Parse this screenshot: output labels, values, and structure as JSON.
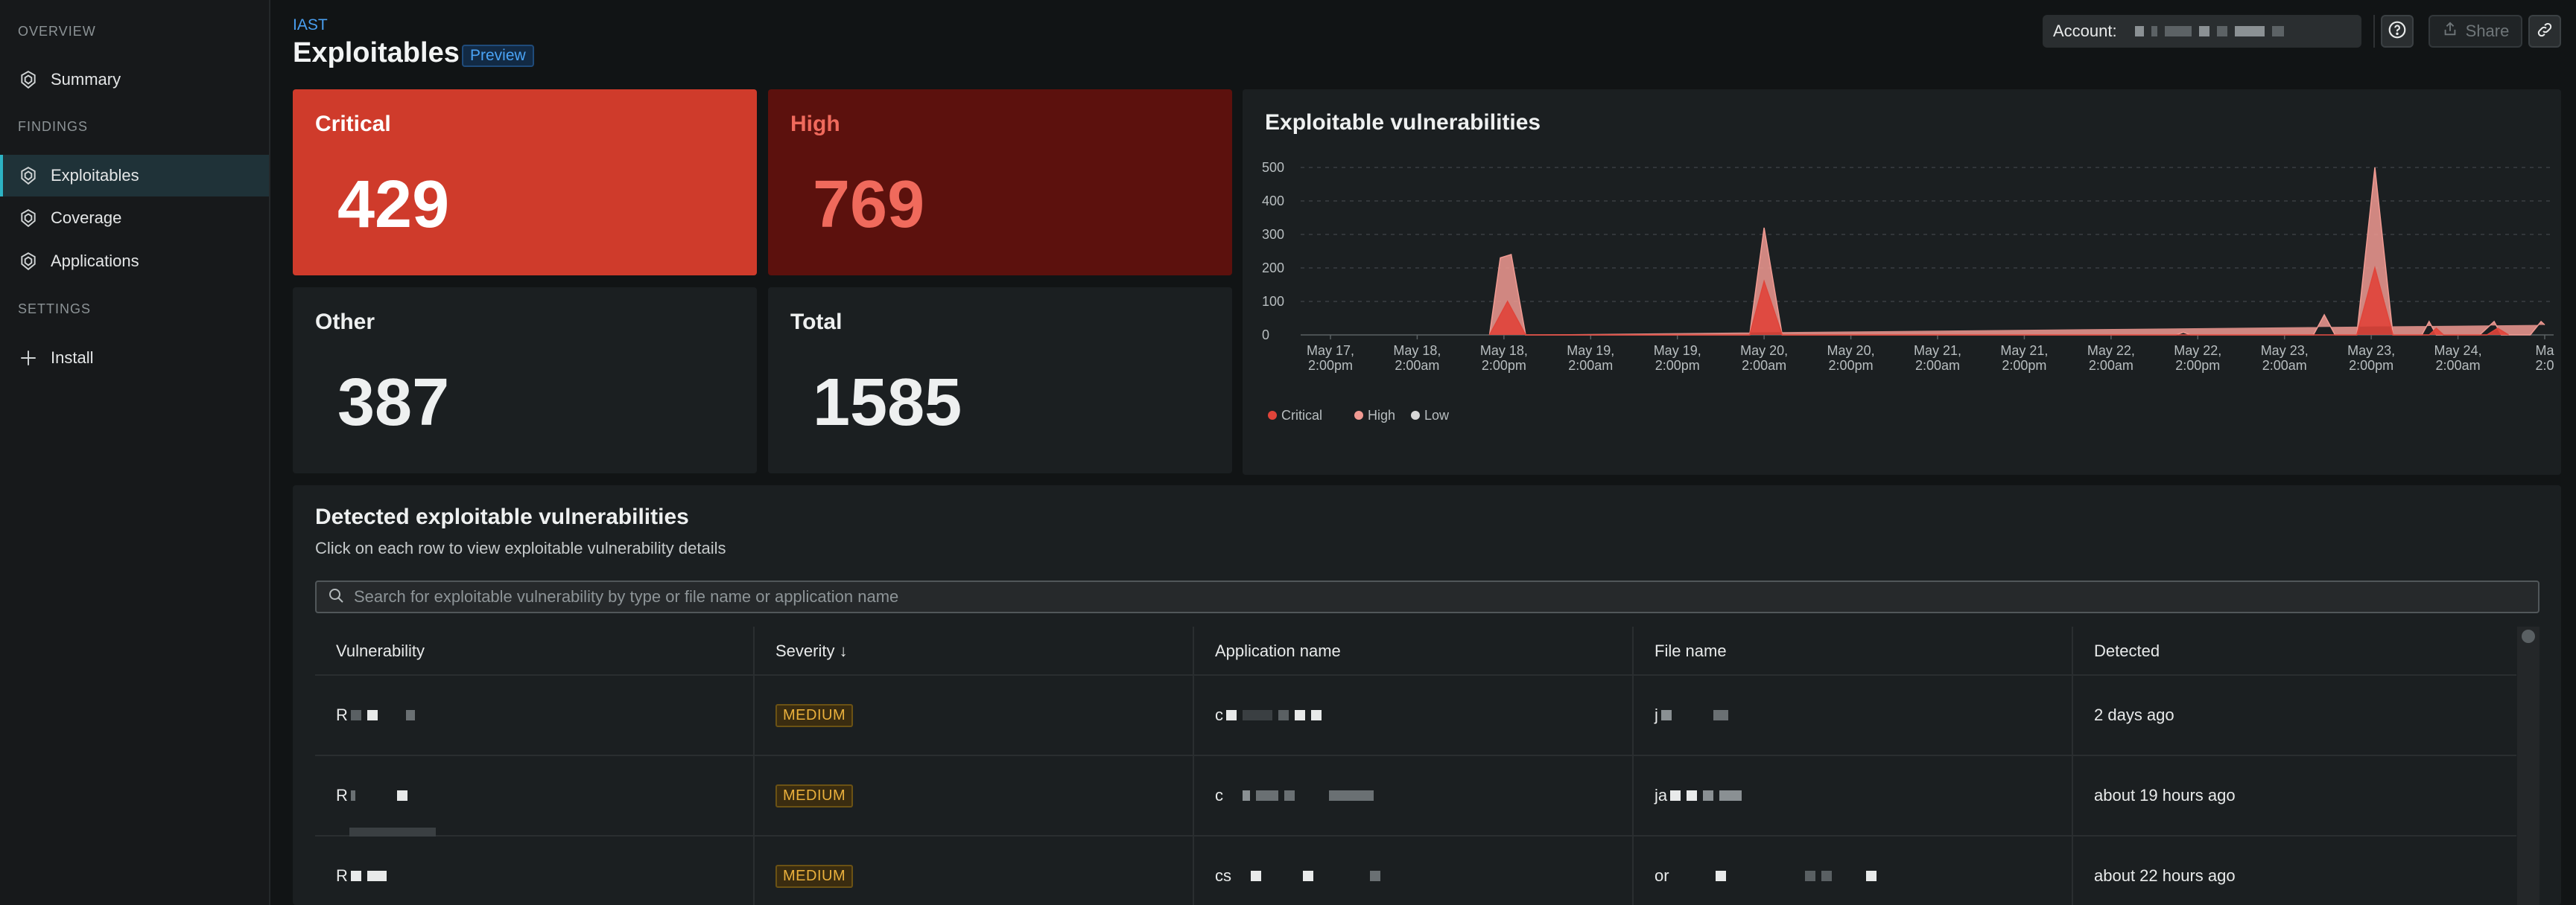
{
  "sidebar": {
    "sections": [
      {
        "title": "OVERVIEW",
        "items": [
          {
            "label": "Summary",
            "icon": "shield-icon"
          }
        ]
      },
      {
        "title": "FINDINGS",
        "items": [
          {
            "label": "Exploitables",
            "icon": "shield-icon",
            "active": true
          },
          {
            "label": "Coverage",
            "icon": "shield-icon"
          },
          {
            "label": "Applications",
            "icon": "shield-icon"
          }
        ]
      },
      {
        "title": "SETTINGS",
        "items": [
          {
            "label": "Install",
            "icon": "plus-icon"
          }
        ]
      }
    ]
  },
  "header": {
    "breadcrumb": "IAST",
    "title": "Exploitables",
    "badge": "Preview",
    "account_label": "Account:",
    "share_label": "Share"
  },
  "stats": {
    "critical": {
      "label": "Critical",
      "value": "429",
      "bg": "#cf3b2b",
      "label_color": "#ffffff",
      "value_color": "#ffffff"
    },
    "high": {
      "label": "High",
      "value": "769",
      "bg": "#5c110d",
      "label_color": "#f06a5c",
      "value_color": "#f06a5c"
    },
    "other": {
      "label": "Other",
      "value": "387",
      "bg": "#1b1f21",
      "label_color": "#eef0f0",
      "value_color": "#eef0f0"
    },
    "total": {
      "label": "Total",
      "value": "1585",
      "bg": "#1b1f21",
      "label_color": "#eef0f0",
      "value_color": "#eef0f0"
    }
  },
  "chart": {
    "title": "Exploitable vulnerabilities"
  },
  "chart_data": {
    "type": "area",
    "title": "Exploitable vulnerabilities",
    "ylim": [
      0,
      500
    ],
    "y_ticks": [
      "500",
      "400",
      "300",
      "200",
      "100",
      "0"
    ],
    "x_tick_labels": [
      [
        "May 17,",
        "2:00pm"
      ],
      [
        "May 18,",
        "2:00am"
      ],
      [
        "May 18,",
        "2:00pm"
      ],
      [
        "May 19,",
        "2:00am"
      ],
      [
        "May 19,",
        "2:00pm"
      ],
      [
        "May 20,",
        "2:00am"
      ],
      [
        "May 20,",
        "2:00pm"
      ],
      [
        "May 21,",
        "2:00am"
      ],
      [
        "May 21,",
        "2:00pm"
      ],
      [
        "May 22,",
        "2:00am"
      ],
      [
        "May 22,",
        "2:00pm"
      ],
      [
        "May 23,",
        "2:00am"
      ],
      [
        "May 23,",
        "2:00pm"
      ],
      [
        "May 24,",
        "2:00am"
      ],
      [
        "Ma",
        "2:0"
      ]
    ],
    "x_hours": [
      0,
      12,
      24,
      36,
      48,
      60,
      72,
      84,
      96,
      108,
      120,
      132,
      144,
      156,
      168
    ],
    "grid": true,
    "legend_position": "bottom-left",
    "series": [
      {
        "name": "Critical",
        "color": "#e0443a",
        "points": [
          [
            22,
            0
          ],
          [
            24.5,
            100
          ],
          [
            27,
            0
          ],
          [
            58,
            0
          ],
          [
            60,
            160
          ],
          [
            62.5,
            0
          ],
          [
            142,
            0
          ],
          [
            144.5,
            200
          ],
          [
            147,
            0
          ],
          [
            152,
            0
          ],
          [
            153,
            20
          ],
          [
            154,
            0
          ],
          [
            160,
            0
          ],
          [
            161.5,
            20
          ],
          [
            163,
            0
          ]
        ]
      },
      {
        "name": "High",
        "color": "#f09a92",
        "points": [
          [
            22,
            0
          ],
          [
            23.5,
            230
          ],
          [
            25,
            240
          ],
          [
            27,
            0
          ],
          [
            58,
            0
          ],
          [
            60,
            320
          ],
          [
            62.5,
            0
          ],
          [
            117,
            0
          ],
          [
            118,
            8
          ],
          [
            119,
            0
          ],
          [
            136,
            0
          ],
          [
            137.5,
            60
          ],
          [
            139,
            0
          ],
          [
            142,
            0
          ],
          [
            144.5,
            500
          ],
          [
            147,
            0
          ],
          [
            151,
            0
          ],
          [
            152,
            40
          ],
          [
            153,
            0
          ],
          [
            159,
            0
          ],
          [
            161,
            40
          ],
          [
            162,
            0
          ],
          [
            166,
            0
          ],
          [
            167.5,
            40
          ],
          [
            168,
            30
          ]
        ]
      },
      {
        "name": "Low",
        "color": "#d8d8d8",
        "points": []
      }
    ]
  },
  "table": {
    "title": "Detected exploitable vulnerabilities",
    "subtitle": "Click on each row to view exploitable vulnerability details",
    "search_placeholder": "Search for exploitable vulnerability by type or file name or application name",
    "columns": [
      "Vulnerability",
      "Severity ↓",
      "Application name",
      "File name",
      "Detected"
    ],
    "rows": [
      {
        "vulnerability": "R",
        "severity": "MEDIUM",
        "application": "c",
        "file": "j",
        "detected": "2 days ago"
      },
      {
        "vulnerability": "R",
        "severity": "MEDIUM",
        "application": "c",
        "file": "ja",
        "detected": "about 19 hours ago"
      },
      {
        "vulnerability": "R",
        "severity": "MEDIUM",
        "application": "cs",
        "file": "or",
        "detected": "about 22 hours ago"
      }
    ]
  }
}
